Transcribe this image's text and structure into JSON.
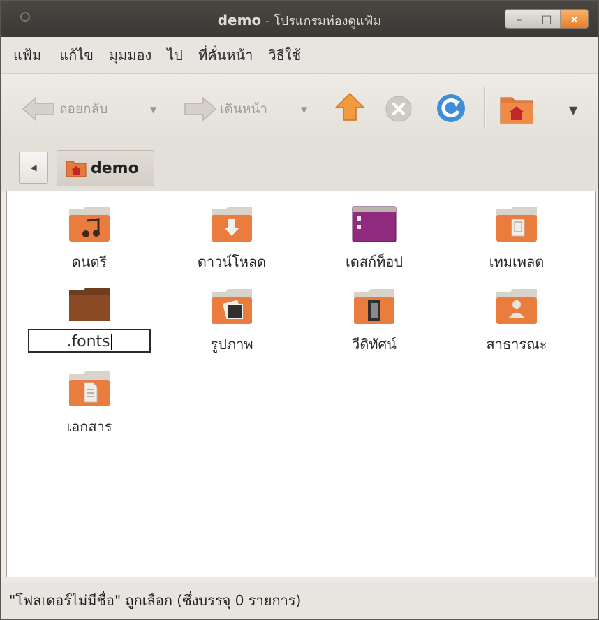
{
  "window": {
    "title_folder": "demo",
    "title_app": " - โปรแกรมท่องดูแฟ้ม",
    "buttons": {
      "minimize": "–",
      "maximize": "□",
      "close": "×"
    }
  },
  "menubar": [
    "แฟ้ม",
    "แก้ไข",
    "มุมมอง",
    "ไป",
    "ที่คั่นหน้า",
    "วิธีใช้"
  ],
  "toolbar": {
    "back_label": "ถอยกลับ",
    "forward_label": "เดินหน้า",
    "dropdown_glyph": "▼"
  },
  "pathbar": {
    "back_glyph": "◀",
    "crumb": "demo"
  },
  "items": [
    {
      "label": "ดนตรี",
      "icon": "music-folder-icon"
    },
    {
      "label": "ดาวน์โหลด",
      "icon": "downloads-folder-icon"
    },
    {
      "label": "เดสก์ท็อป",
      "icon": "desktop-folder-icon"
    },
    {
      "label": "เทมเพลต",
      "icon": "templates-folder-icon"
    },
    {
      "label": ".fonts",
      "icon": "folder-icon",
      "renaming": true
    },
    {
      "label": "รูปภาพ",
      "icon": "pictures-folder-icon"
    },
    {
      "label": "วีดิทัศน์",
      "icon": "videos-folder-icon"
    },
    {
      "label": "สาธารณะ",
      "icon": "public-folder-icon"
    },
    {
      "label": "เอกสาร",
      "icon": "documents-folder-icon"
    }
  ],
  "status": "\"โฟลเดอร์ไม่มีชื่อ\" ถูกเลือก (ซึ่งบรรจุ 0 รายการ)"
}
